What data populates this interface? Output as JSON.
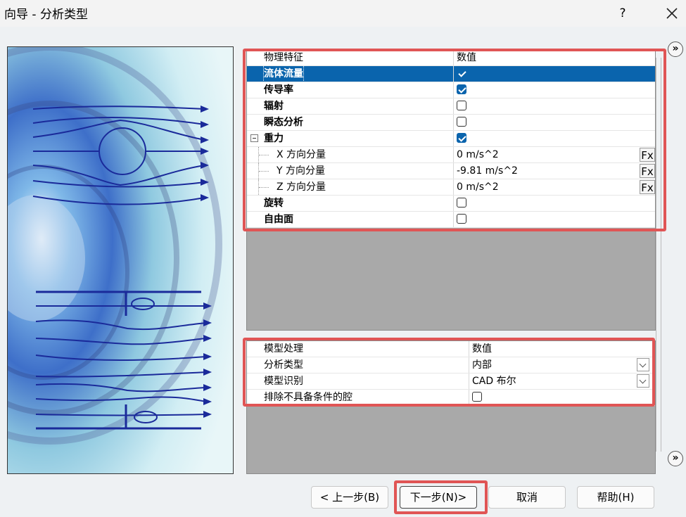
{
  "window": {
    "title": "向导 - 分析类型",
    "help_symbol": "?"
  },
  "properties": {
    "header": {
      "name": "物理特征",
      "value": "数值"
    },
    "rows": [
      {
        "label": "流体流量",
        "bold": true,
        "selected": true,
        "checkbox": true,
        "checked": true
      },
      {
        "label": "传导率",
        "bold": true,
        "checkbox": true,
        "checked": true
      },
      {
        "label": "辐射",
        "bold": true,
        "checkbox": true,
        "checked": false
      },
      {
        "label": "瞬态分析",
        "bold": true,
        "checkbox": true,
        "checked": false
      },
      {
        "label": "重力",
        "bold": true,
        "checkbox": true,
        "checked": true,
        "expanded": true
      },
      {
        "label": "X 方向分量",
        "child": true,
        "value": "0 m/s^2",
        "fx": "Fx"
      },
      {
        "label": "Y 方向分量",
        "child": true,
        "value": "-9.81 m/s^2",
        "fx": "Fx"
      },
      {
        "label": "Z 方向分量",
        "child": true,
        "value": "0 m/s^2",
        "fx": "Fx"
      },
      {
        "label": "旋转",
        "bold": true,
        "checkbox": true,
        "checked": false
      },
      {
        "label": "自由面",
        "bold": true,
        "checkbox": true,
        "checked": false
      }
    ]
  },
  "model": {
    "header": {
      "name": "模型处理",
      "value": "数值"
    },
    "rows": [
      {
        "label": "分析类型",
        "value": "内部",
        "dropdown": true
      },
      {
        "label": "模型识别",
        "value": "CAD 布尔",
        "dropdown": true
      },
      {
        "label": "排除不具备条件的腔",
        "checkbox": true,
        "checked": false
      }
    ]
  },
  "buttons": {
    "back": "< 上一步(B)",
    "next": "下一步(N)>",
    "cancel": "取消",
    "help": "帮助(H)"
  },
  "scroll_buttons": {
    "up": "»",
    "down": "»"
  },
  "colors": {
    "selection": "#0a64ad",
    "highlight": "#e05555",
    "grid_bg": "#a9a9a9"
  }
}
